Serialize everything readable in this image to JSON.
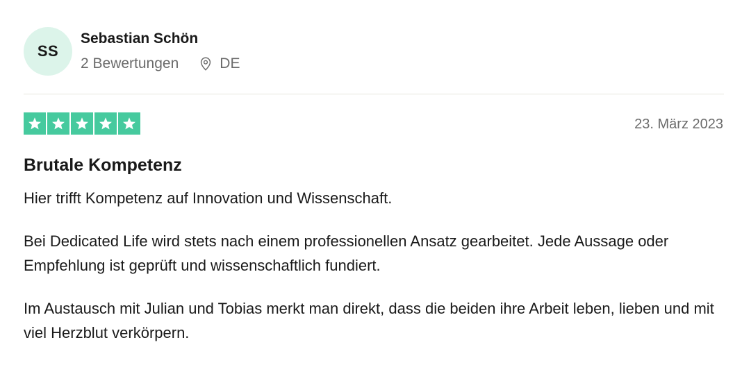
{
  "user": {
    "initials": "SS",
    "name": "Sebastian Schön",
    "reviews_count": "2 Bewertungen",
    "country": "DE",
    "location_icon": "location-pin-icon"
  },
  "review": {
    "rating": 5,
    "rating_max": 5,
    "star_color": "#00b67a",
    "date": "23. März 2023",
    "title": "Brutale Kompetenz",
    "paragraphs": [
      "Hier trifft Kompetenz auf Innovation und Wissenschaft.",
      "Bei Dedicated Life wird stets nach einem professionellen Ansatz gearbeitet. Jede Aussage oder Empfehlung ist geprüft und wissenschaftlich fundiert.",
      "Im Austausch mit Julian und Tobias merkt man direkt, dass die beiden ihre Arbeit leben, lieben und mit viel Herzblut verkörpern."
    ]
  },
  "colors": {
    "avatar_bg": "#dcf4ea",
    "text_primary": "#191919",
    "text_secondary": "#6b6b6b",
    "divider": "#e5e5dd"
  }
}
